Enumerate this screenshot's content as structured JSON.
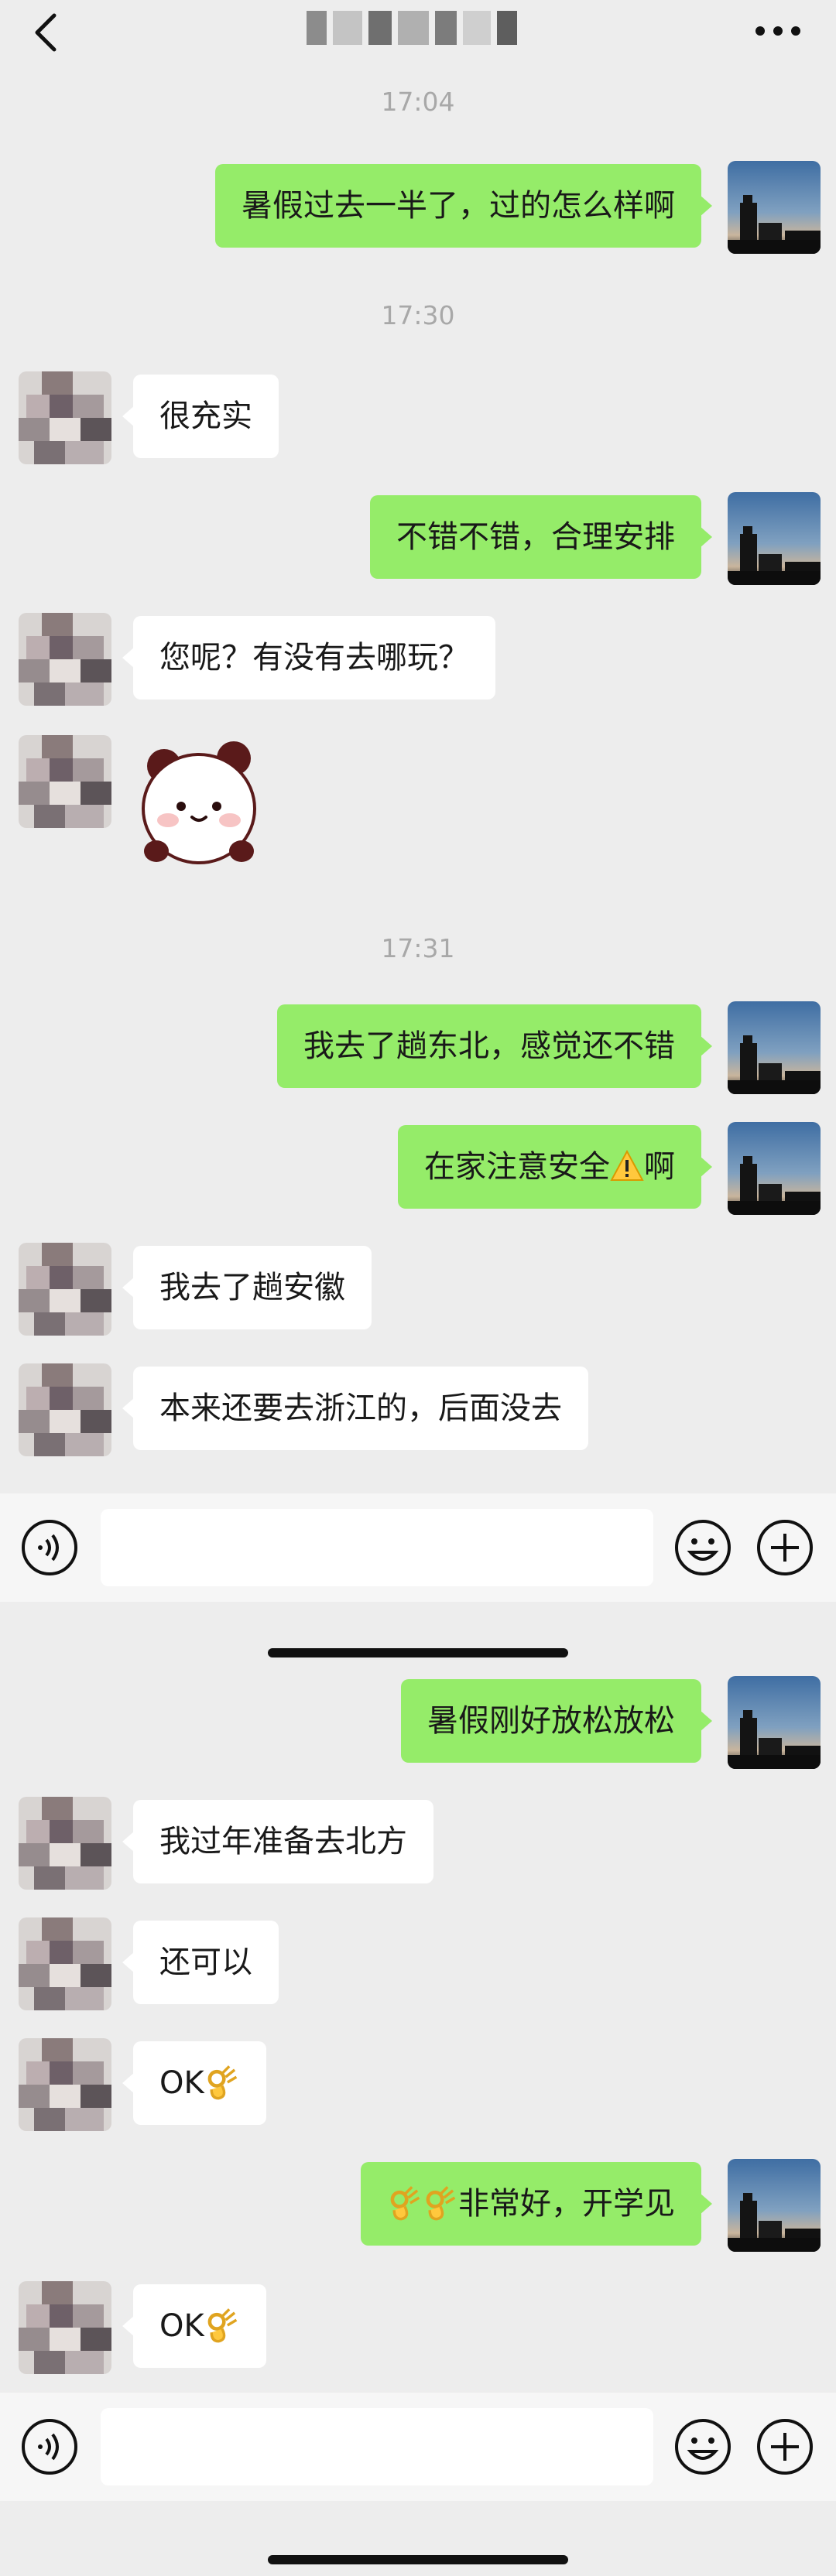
{
  "screen1": {
    "nav": {
      "back_icon": "chevron-left-icon",
      "more_icon": "more-dots-icon"
    },
    "times": [
      "17:04",
      "17:30",
      "17:31"
    ],
    "messages": [
      {
        "side": "me",
        "text": "暑假过去一半了，过的怎么样啊"
      },
      {
        "side": "other",
        "text": "很充实"
      },
      {
        "side": "me",
        "text": "不错不错，合理安排"
      },
      {
        "side": "other",
        "text": "您呢？有没有去哪玩？"
      },
      {
        "side": "other",
        "type": "sticker",
        "sticker": "panda-sticker"
      },
      {
        "side": "me",
        "text": "我去了趟东北，感觉还不错"
      },
      {
        "side": "me",
        "text_before": "在家注意安全",
        "emoji": "warning-emoji",
        "text_after": "啊"
      },
      {
        "side": "other",
        "text": "我去了趟安徽"
      },
      {
        "side": "other",
        "text": "本来还要去浙江的，后面没去"
      }
    ]
  },
  "screen2": {
    "messages": [
      {
        "side": "me",
        "text": "暑假刚好放松放松"
      },
      {
        "side": "other",
        "text": "我过年准备去北方"
      },
      {
        "side": "other",
        "text": "还可以"
      },
      {
        "side": "other",
        "text": "OK",
        "emoji": "ok-hand-emoji"
      },
      {
        "side": "me",
        "emoji": "ok-hand-emoji",
        "text": "非常好，开学见"
      },
      {
        "side": "other",
        "text": "OK",
        "emoji": "ok-hand-emoji"
      }
    ]
  },
  "colors": {
    "my_bubble": "#95ec69",
    "their_bubble": "#ffffff",
    "background": "#ededed",
    "timestamp": "#a8a8a8"
  }
}
